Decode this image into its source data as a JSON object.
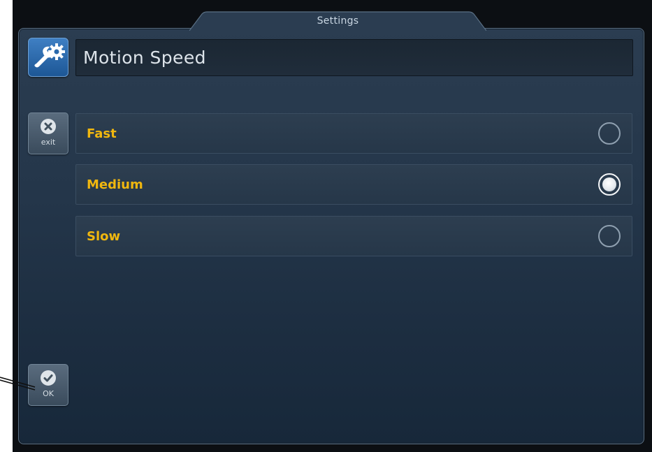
{
  "window": {
    "title": "Settings"
  },
  "header": {
    "title": "Motion Speed",
    "icon": "wrench-gear-icon"
  },
  "sidebar": {
    "exit": {
      "label": "exit",
      "icon": "close-circle-icon"
    },
    "ok": {
      "label": "OK",
      "icon": "check-circle-icon"
    }
  },
  "options": [
    {
      "label": "Fast",
      "selected": false
    },
    {
      "label": "Medium",
      "selected": true
    },
    {
      "label": "Slow",
      "selected": false
    }
  ],
  "colors": {
    "accent_text": "#f0b70f",
    "header_icon": "#2a69ab",
    "panel": "#24364a"
  }
}
